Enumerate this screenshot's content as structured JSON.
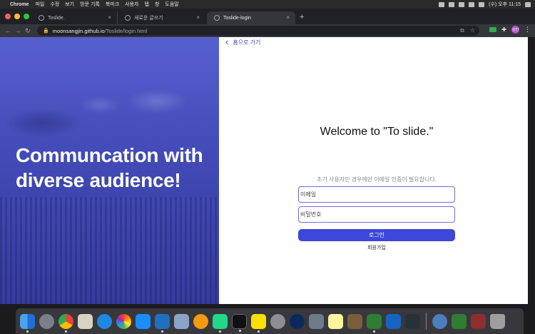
{
  "menubar": {
    "app_name": "Chrome",
    "items": [
      "파일",
      "수정",
      "보기",
      "방문 기록",
      "북마크",
      "사용자",
      "탭",
      "창",
      "도움말"
    ],
    "clock": "(수) 오후 11:15"
  },
  "tabs": [
    {
      "title": "Toslide."
    },
    {
      "title": "새로운 글쓰기"
    },
    {
      "title": "Toslide-login"
    }
  ],
  "address": {
    "host": "moonsangjin.github.io",
    "path": "/Toslide/login.html"
  },
  "profile_initial": "상진",
  "page": {
    "home_link": "홈으로 가기",
    "hero_title": "Communcation with diverse audience!",
    "welcome": "Welcome to \"To slide.\"",
    "notice": "초기 사용자인 경우에만 이메일 인증이 필요합니다.",
    "email_placeholder": "이메일",
    "password_placeholder": "비밀번호",
    "login_button": "로그인",
    "signup_link": "회원가입"
  },
  "colors": {
    "hero": "#4d57cc",
    "accent": "#3d47da",
    "field_border": "#6b6fdc"
  },
  "dock_apps": [
    "finder-icon",
    "launchpad-icon",
    "chrome-icon",
    "notes-icon",
    "safari-icon",
    "photos-icon",
    "app-store-icon",
    "vscode-icon",
    "preview-icon",
    "goldfish-icon",
    "clion-icon",
    "terminal-icon",
    "kakaotalk-icon",
    "system-preferences-icon",
    "quicktime-icon",
    "image-capture-icon",
    "stickies-icon",
    "archive-icon",
    "utorrent-icon",
    "books-icon",
    "activity-monitor-icon",
    "finder-recent-icon",
    "facetime-icon",
    "dictionary-icon",
    "trash-icon"
  ]
}
